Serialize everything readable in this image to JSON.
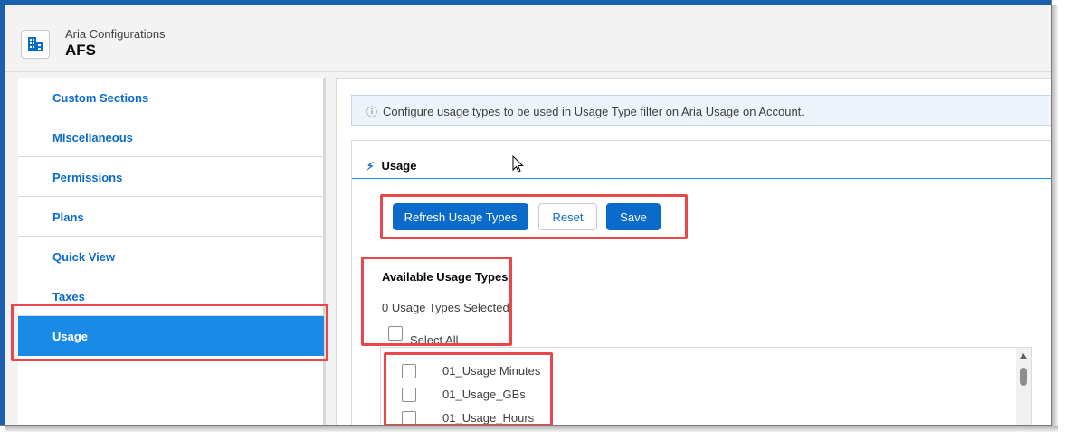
{
  "app": {
    "subtitle": "Aria Configurations",
    "title": "AFS",
    "icon": "building-grid-icon"
  },
  "sidebar": {
    "items": [
      {
        "label": "Custom Sections",
        "active": false
      },
      {
        "label": "Miscellaneous",
        "active": false
      },
      {
        "label": "Permissions",
        "active": false
      },
      {
        "label": "Plans",
        "active": false
      },
      {
        "label": "Quick View",
        "active": false
      },
      {
        "label": "Taxes",
        "active": false
      },
      {
        "label": "Usage",
        "active": true
      }
    ]
  },
  "main": {
    "info_icon": "info-icon",
    "info_text": "Configure usage types to be used in Usage Type filter on Aria Usage on Account.",
    "card": {
      "title": "Usage",
      "title_icon": "bolt-icon",
      "buttons": {
        "refresh": "Refresh Usage Types",
        "reset": "Reset",
        "save": "Save"
      },
      "available_label": "Available Usage Types",
      "selected_count": "0 Usage Types Selected",
      "select_all_label": "Select All",
      "usage_types": [
        {
          "label": "01_Usage Minutes",
          "checked": false
        },
        {
          "label": "01_Usage_GBs",
          "checked": false
        },
        {
          "label": "01_Usage_Hours",
          "checked": false
        }
      ]
    }
  },
  "colors": {
    "brand_blue": "#0b6bcb",
    "active_item": "#1b8ae6",
    "highlight_red": "#e8484a"
  }
}
